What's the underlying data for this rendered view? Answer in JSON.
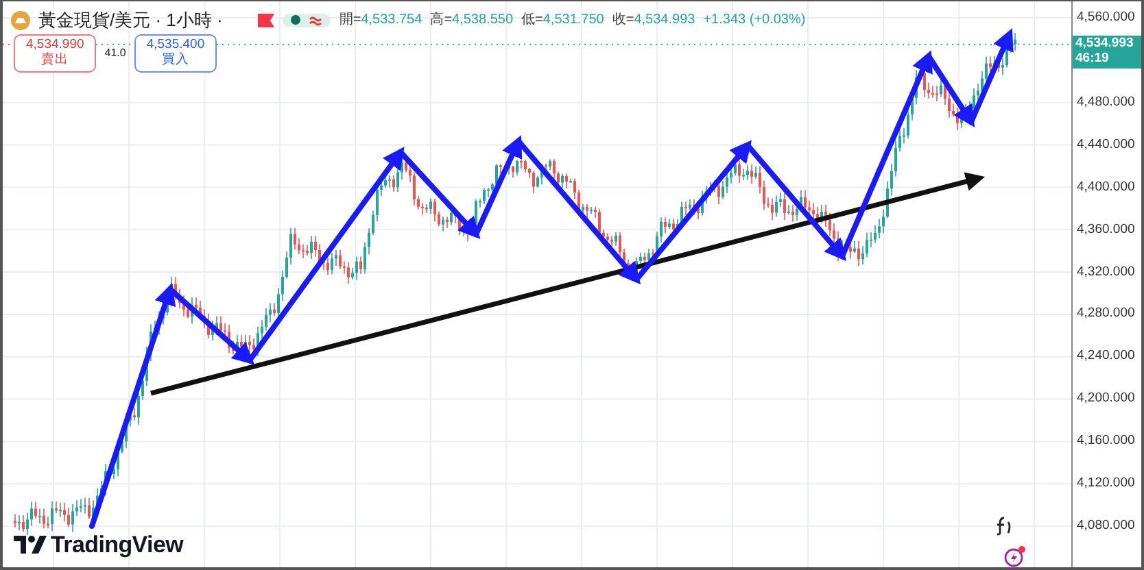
{
  "legend": {
    "title": "黃金現貨/美元 · 1小時 ·",
    "ohlc": [
      {
        "label": "開=",
        "value": "4,533.754"
      },
      {
        "label": "高=",
        "value": "4,538.550"
      },
      {
        "label": "低=",
        "value": "4,531.750"
      },
      {
        "label": "收=",
        "value": "4,534.993"
      }
    ],
    "change": "+1.343 (+0.03%)"
  },
  "trade": {
    "sell": {
      "price": "4,534.990",
      "label": "賣出"
    },
    "spread": "41.0",
    "buy": {
      "price": "4,535.400",
      "label": "買入"
    }
  },
  "price_axis": {
    "ticks": [
      "4,560.000",
      "4,480.000",
      "4,440.000",
      "4,400.000",
      "4,360.000",
      "4,320.000",
      "4,280.000",
      "4,240.000",
      "4,200.000",
      "4,160.000",
      "4,120.000",
      "4,080.000"
    ],
    "last_price": "4,534.993",
    "countdown": "46:19"
  },
  "logo": "TradingView"
}
